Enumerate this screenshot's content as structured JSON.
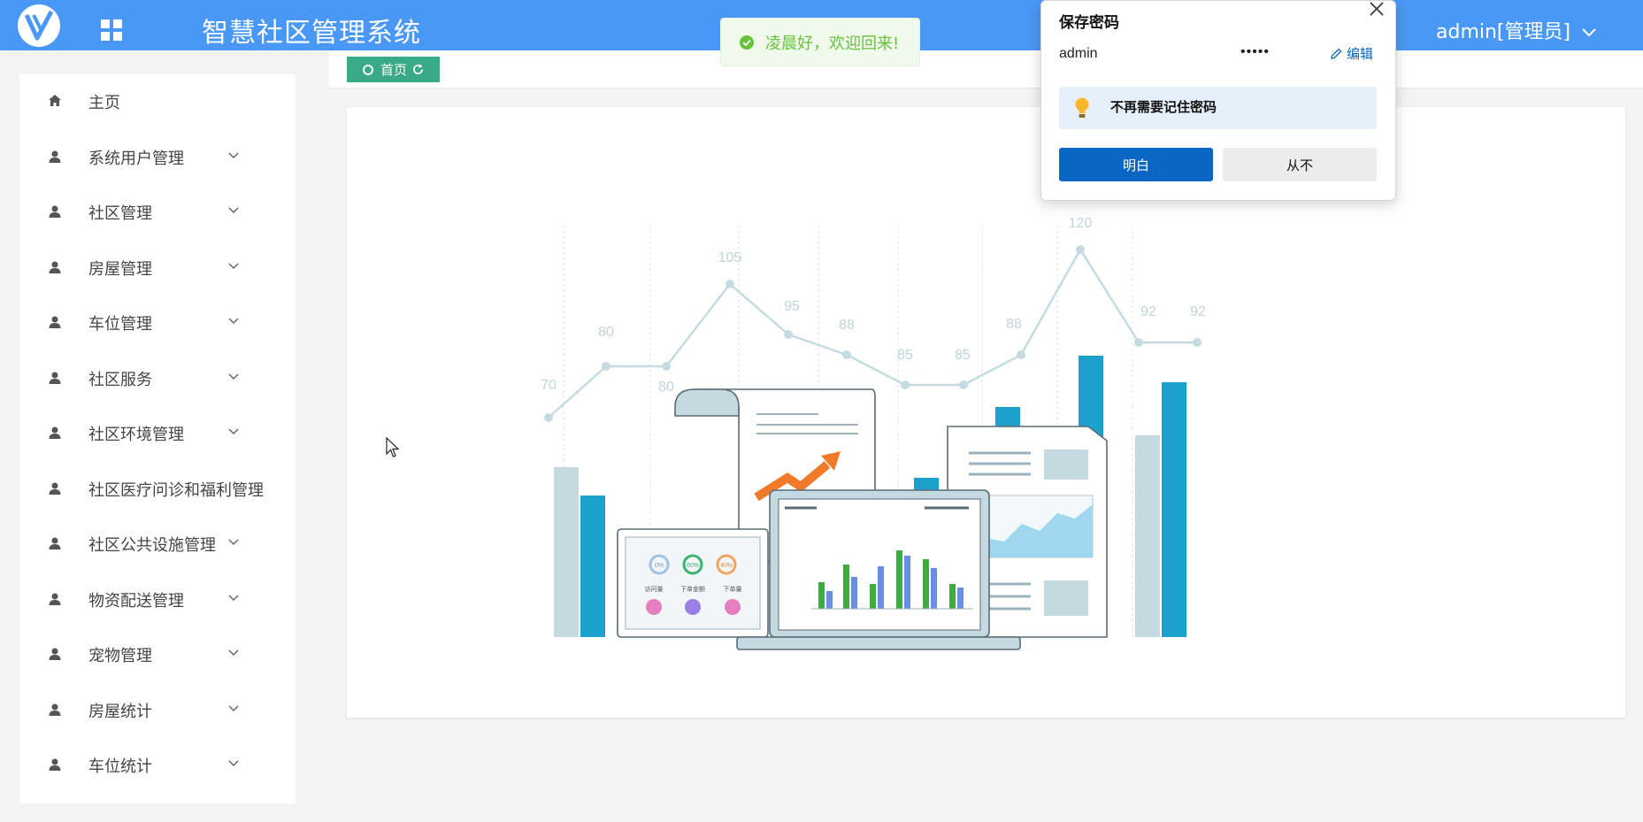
{
  "header": {
    "app_title": "智慧社区管理系统",
    "user_label": "admin[管理员]"
  },
  "toast": {
    "message": "凌晨好，欢迎回来!"
  },
  "sidebar": {
    "items": [
      {
        "label": "主页",
        "icon": "home-icon",
        "expandable": false
      },
      {
        "label": "系统用户管理",
        "icon": "user-icon",
        "expandable": true
      },
      {
        "label": "社区管理",
        "icon": "user-icon",
        "expandable": true
      },
      {
        "label": "房屋管理",
        "icon": "user-icon",
        "expandable": true
      },
      {
        "label": "车位管理",
        "icon": "user-icon",
        "expandable": true
      },
      {
        "label": "社区服务",
        "icon": "user-icon",
        "expandable": true
      },
      {
        "label": "社区环境管理",
        "icon": "user-icon",
        "expandable": true
      },
      {
        "label": "社区医疗问诊和福利管理",
        "icon": "user-icon",
        "expandable": false
      },
      {
        "label": "社区公共设施管理",
        "icon": "user-icon",
        "expandable": true
      },
      {
        "label": "物资配送管理",
        "icon": "user-icon",
        "expandable": true
      },
      {
        "label": "宠物管理",
        "icon": "user-icon",
        "expandable": true
      },
      {
        "label": "房屋统计",
        "icon": "user-icon",
        "expandable": true
      },
      {
        "label": "车位统计",
        "icon": "user-icon",
        "expandable": true
      }
    ]
  },
  "tabs": {
    "home_label": "首页"
  },
  "illustration": {
    "line_values": [
      "70",
      "80",
      "80",
      "105",
      "95",
      "88",
      "85",
      "85",
      "88",
      "120",
      "92",
      "92"
    ],
    "laptop_mini_labels": [
      "访问量",
      "下单金额",
      "下单量"
    ],
    "mini_percents": [
      "0%",
      "60%",
      "40%"
    ]
  },
  "password_dialog": {
    "title": "保存密码",
    "username": "admin",
    "password_mask": "•••••",
    "edit_label": "编辑",
    "tip": "不再需要记住密码",
    "ok_label": "明白",
    "never_label": "从不"
  },
  "colors": {
    "topbar": "#4a98f5",
    "tab_green": "#3aa986",
    "dialog_primary": "#0a66c2",
    "bar_dark": "#1ba1cb",
    "bar_light": "#bcd6df"
  }
}
